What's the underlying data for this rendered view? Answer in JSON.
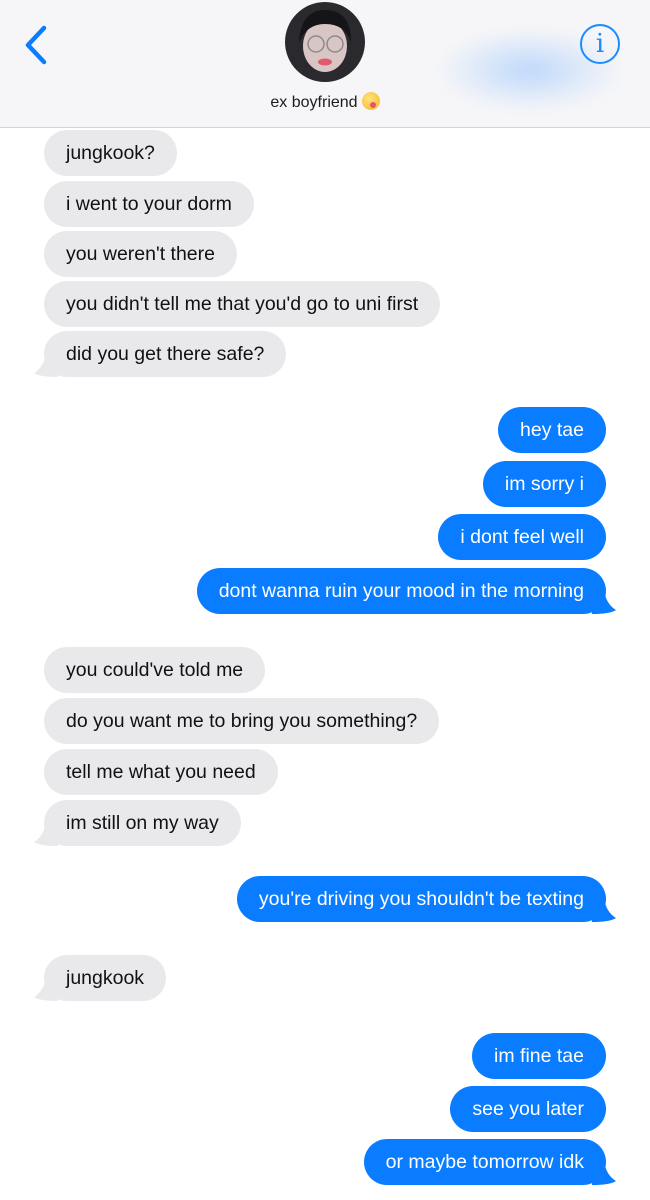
{
  "header": {
    "contact_name": "ex boyfriend",
    "back_icon": "chevron-left-icon",
    "info_icon": "info-icon",
    "accent_color": "#0a7cff"
  },
  "messages": [
    {
      "from": "them",
      "text": "jungkook?"
    },
    {
      "from": "them",
      "text": "i went to your dorm"
    },
    {
      "from": "them",
      "text": "you weren't there"
    },
    {
      "from": "them",
      "text": "you didn't tell me that you'd go to uni first"
    },
    {
      "from": "them",
      "text": "did you get there safe?"
    },
    {
      "from": "me",
      "text": "hey tae"
    },
    {
      "from": "me",
      "text": "im sorry i"
    },
    {
      "from": "me",
      "text": "i dont feel well"
    },
    {
      "from": "me",
      "text": "dont wanna ruin your mood in the morning"
    },
    {
      "from": "them",
      "text": "you could've told me"
    },
    {
      "from": "them",
      "text": "do you want me to bring you something?"
    },
    {
      "from": "them",
      "text": "tell me what you need"
    },
    {
      "from": "them",
      "text": "im still on my way"
    },
    {
      "from": "me",
      "text": "you're driving you shouldn't be texting"
    },
    {
      "from": "them",
      "text": "jungkook"
    },
    {
      "from": "me",
      "text": "im fine tae"
    },
    {
      "from": "me",
      "text": "see you later"
    },
    {
      "from": "me",
      "text": "or maybe tomorrow idk"
    }
  ]
}
